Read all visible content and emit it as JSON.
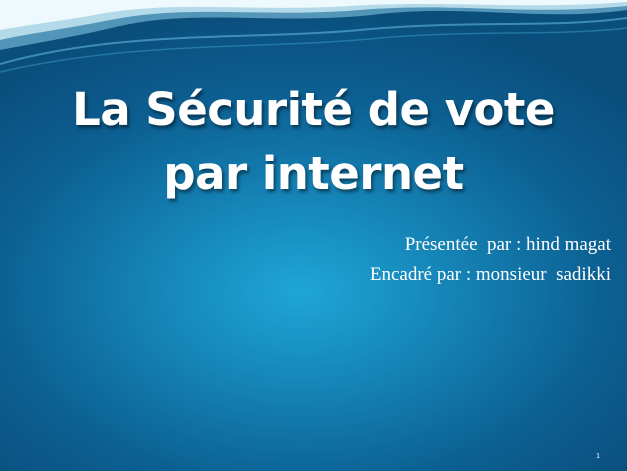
{
  "slide": {
    "title_line1": "La Sécurité de vote",
    "title_line2": "par internet",
    "presenter": "Présentée  par : hind magat",
    "supervisor": "Encadré par : monsieur  sadikki",
    "number": "1"
  },
  "colors": {
    "background": "#1583b6",
    "background_edge": "#0a4f7c",
    "wave": "#dff3fb",
    "text": "#ffffff"
  }
}
